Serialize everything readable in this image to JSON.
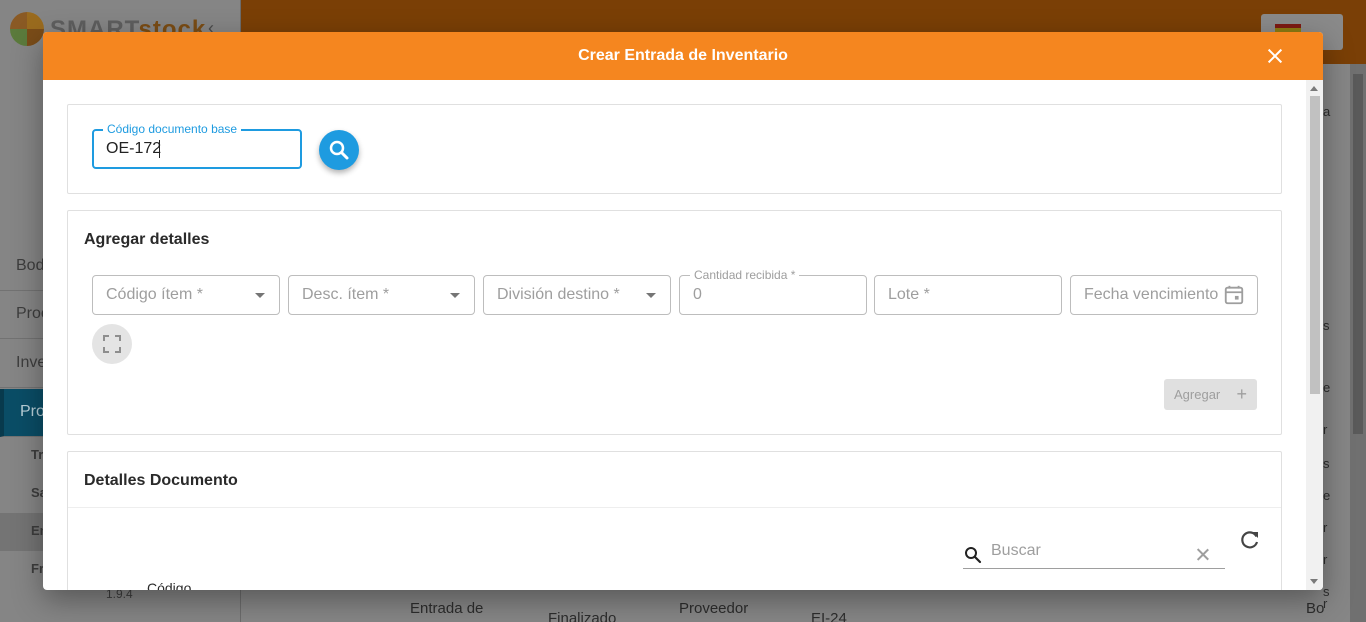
{
  "background": {
    "brand": {
      "smart": "SMART",
      "stock": "stock"
    },
    "nav_items": [
      "Bod",
      "Proc",
      "Inve",
      "Pro"
    ],
    "sub_items": [
      "Tr",
      "Sa",
      "En",
      "Fr"
    ],
    "version": "1.9.4",
    "row": {
      "col1": "Entrada de",
      "col2": "Finalizado",
      "col3": "Proveedor",
      "col4": "EI-24",
      "col5": "Bo"
    },
    "right_letters": [
      "a",
      "s",
      "e",
      "r",
      "s",
      "e",
      "r",
      "r",
      "s",
      "r"
    ]
  },
  "modal": {
    "title": "Crear Entrada de Inventario",
    "base_doc": {
      "label": "Código documento base",
      "value": "OE-172"
    },
    "add_details": {
      "title": "Agregar detalles",
      "fields": [
        {
          "placeholder": "Código ítem *"
        },
        {
          "placeholder": "Desc. ítem *"
        },
        {
          "placeholder": "División destino *"
        }
      ],
      "quantity": {
        "label": "Cantidad recibida *",
        "value": "0"
      },
      "lot": {
        "placeholder": "Lote *"
      },
      "expiry": {
        "placeholder": "Fecha vencimiento"
      },
      "add_button": "Agregar",
      "add_button_icon": "+"
    },
    "doc_details": {
      "title": "Detalles Documento",
      "search_placeholder": "Buscar",
      "first_column": "Código"
    }
  },
  "colors": {
    "header": "#f5861f",
    "accent": "#1e9be0"
  },
  "icons": [
    "close-icon",
    "search-icon",
    "chevron-down-icon",
    "calendar-icon",
    "fullscreen-icon",
    "refresh-icon",
    "clear-icon"
  ]
}
